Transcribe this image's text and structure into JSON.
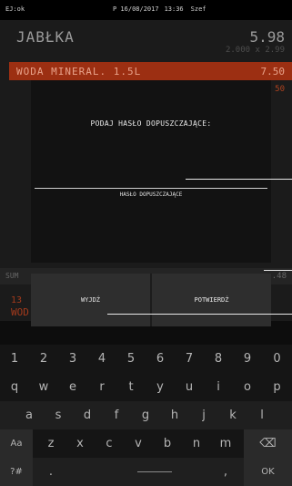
{
  "status_bar": {
    "left": "EJ:ok",
    "printer": "P 16/08/2017",
    "time": "13:36",
    "user": "Szef"
  },
  "receipt": {
    "items": [
      {
        "name": "JABŁKA",
        "price": "5.98",
        "qty_line": "2.000 x 2.99"
      },
      {
        "name": "WODA MINERAL. 1.5L",
        "price": "7.50",
        "sub": "50",
        "selected": true
      }
    ],
    "sum_label": "SUM",
    "sum_value": ".48",
    "count": "13",
    "current_name": "WOD"
  },
  "dialog": {
    "title": "PODAJ HASŁO DOPUSZCZAJĄCE:",
    "field_label": "HASŁO DOPUSZCZAJĄCE",
    "exit_label": "WYJDŹ",
    "confirm_label": "POTWIERDŹ"
  },
  "keyboard": {
    "row1": [
      "1",
      "2",
      "3",
      "4",
      "5",
      "6",
      "7",
      "8",
      "9",
      "0"
    ],
    "row2": [
      "q",
      "w",
      "e",
      "r",
      "t",
      "y",
      "u",
      "i",
      "o",
      "p"
    ],
    "row3": [
      "a",
      "s",
      "d",
      "f",
      "g",
      "h",
      "j",
      "k",
      "l"
    ],
    "row4": [
      "Aa",
      "z",
      "x",
      "c",
      "v",
      "b",
      "n",
      "m",
      "⌫"
    ],
    "row5": {
      "symbols": "?#",
      "dot": ".",
      "comma": ",",
      "ok": "OK"
    }
  },
  "colors": {
    "accent": "#9c2f12",
    "background": "#0d0d0d"
  }
}
